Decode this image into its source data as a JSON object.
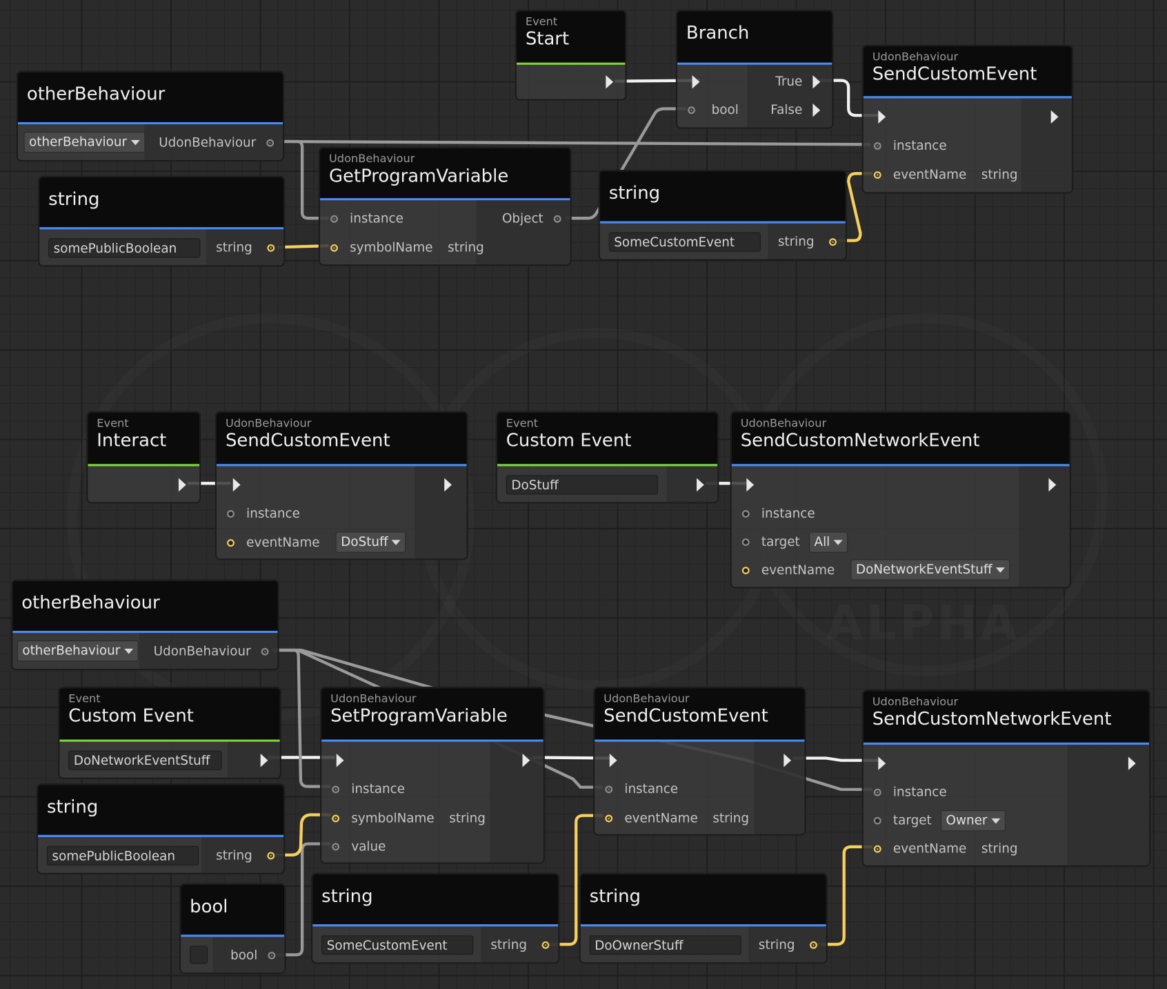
{
  "app": {
    "view": "Udon Graph editor"
  },
  "watermark": {
    "text": "ALPHA"
  },
  "nodes": {
    "start": {
      "sub": "Event",
      "title": "Start"
    },
    "branch": {
      "title": "Branch",
      "bool_label": "bool",
      "true_label": "True",
      "false_label": "False"
    },
    "sce1": {
      "sub": "UdonBehaviour",
      "title": "SendCustomEvent",
      "instance": "instance",
      "eventName": "eventName",
      "eventName_type": "string"
    },
    "otherBehaviour1": {
      "title": "otherBehaviour",
      "dropdown": "otherBehaviour",
      "out_type": "UdonBehaviour"
    },
    "getProgVar": {
      "sub": "UdonBehaviour",
      "title": "GetProgramVariable",
      "instance": "instance",
      "out_type": "Object",
      "symbolName": "symbolName",
      "symbolName_type": "string"
    },
    "string1": {
      "title": "string",
      "value": "somePublicBoolean",
      "out_type": "string"
    },
    "string2": {
      "title": "string",
      "value": "SomeCustomEvent",
      "out_type": "string"
    },
    "interact": {
      "sub": "Event",
      "title": "Interact"
    },
    "sce2": {
      "sub": "UdonBehaviour",
      "title": "SendCustomEvent",
      "instance": "instance",
      "eventName": "eventName",
      "eventName_value": "DoStuff"
    },
    "customEvent1": {
      "sub": "Event",
      "title": "Custom Event",
      "value": "DoStuff"
    },
    "scne1": {
      "sub": "UdonBehaviour",
      "title": "SendCustomNetworkEvent",
      "instance": "instance",
      "target": "target",
      "target_value": "All",
      "eventName": "eventName",
      "eventName_value": "DoNetworkEventStuff"
    },
    "otherBehaviour2": {
      "title": "otherBehaviour",
      "dropdown": "otherBehaviour",
      "out_type": "UdonBehaviour"
    },
    "customEvent2": {
      "sub": "Event",
      "title": "Custom Event",
      "value": "DoNetworkEventStuff"
    },
    "setProgVar": {
      "sub": "UdonBehaviour",
      "title": "SetProgramVariable",
      "instance": "instance",
      "symbolName": "symbolName",
      "symbolName_type": "string",
      "value": "value"
    },
    "sce3": {
      "sub": "UdonBehaviour",
      "title": "SendCustomEvent",
      "instance": "instance",
      "eventName": "eventName",
      "eventName_type": "string"
    },
    "scne2": {
      "sub": "UdonBehaviour",
      "title": "SendCustomNetworkEvent",
      "instance": "instance",
      "target": "target",
      "target_value": "Owner",
      "eventName": "eventName",
      "eventName_type": "string"
    },
    "string3": {
      "title": "string",
      "value": "somePublicBoolean",
      "out_type": "string"
    },
    "bool1": {
      "title": "bool",
      "out_type": "bool",
      "checked": false
    },
    "string4": {
      "title": "string",
      "value": "SomeCustomEvent",
      "out_type": "string"
    },
    "string5": {
      "title": "string",
      "value": "DoOwnerStuff",
      "out_type": "string"
    }
  },
  "colors": {
    "flow_wire": "#f2f2f2",
    "object_wire": "#9a9a9a",
    "string_wire": "#f7cf5c",
    "event_accent": "#7dd33c",
    "node_accent": "#4a8af4"
  }
}
